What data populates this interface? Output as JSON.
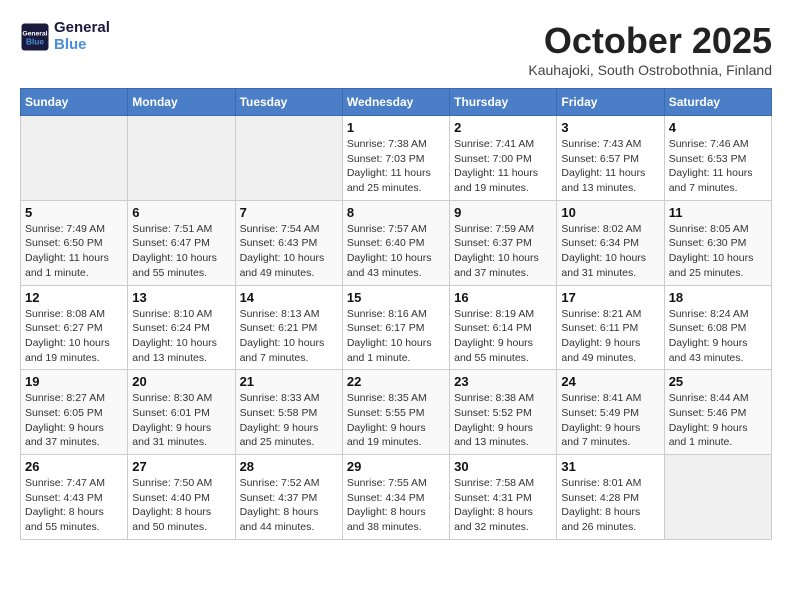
{
  "header": {
    "logo_line1": "General",
    "logo_line2": "Blue",
    "month": "October 2025",
    "location": "Kauhajoki, South Ostrobothnia, Finland"
  },
  "weekdays": [
    "Sunday",
    "Monday",
    "Tuesday",
    "Wednesday",
    "Thursday",
    "Friday",
    "Saturday"
  ],
  "weeks": [
    [
      {
        "day": "",
        "info": ""
      },
      {
        "day": "",
        "info": ""
      },
      {
        "day": "",
        "info": ""
      },
      {
        "day": "1",
        "info": "Sunrise: 7:38 AM\nSunset: 7:03 PM\nDaylight: 11 hours\nand 25 minutes."
      },
      {
        "day": "2",
        "info": "Sunrise: 7:41 AM\nSunset: 7:00 PM\nDaylight: 11 hours\nand 19 minutes."
      },
      {
        "day": "3",
        "info": "Sunrise: 7:43 AM\nSunset: 6:57 PM\nDaylight: 11 hours\nand 13 minutes."
      },
      {
        "day": "4",
        "info": "Sunrise: 7:46 AM\nSunset: 6:53 PM\nDaylight: 11 hours\nand 7 minutes."
      }
    ],
    [
      {
        "day": "5",
        "info": "Sunrise: 7:49 AM\nSunset: 6:50 PM\nDaylight: 11 hours\nand 1 minute."
      },
      {
        "day": "6",
        "info": "Sunrise: 7:51 AM\nSunset: 6:47 PM\nDaylight: 10 hours\nand 55 minutes."
      },
      {
        "day": "7",
        "info": "Sunrise: 7:54 AM\nSunset: 6:43 PM\nDaylight: 10 hours\nand 49 minutes."
      },
      {
        "day": "8",
        "info": "Sunrise: 7:57 AM\nSunset: 6:40 PM\nDaylight: 10 hours\nand 43 minutes."
      },
      {
        "day": "9",
        "info": "Sunrise: 7:59 AM\nSunset: 6:37 PM\nDaylight: 10 hours\nand 37 minutes."
      },
      {
        "day": "10",
        "info": "Sunrise: 8:02 AM\nSunset: 6:34 PM\nDaylight: 10 hours\nand 31 minutes."
      },
      {
        "day": "11",
        "info": "Sunrise: 8:05 AM\nSunset: 6:30 PM\nDaylight: 10 hours\nand 25 minutes."
      }
    ],
    [
      {
        "day": "12",
        "info": "Sunrise: 8:08 AM\nSunset: 6:27 PM\nDaylight: 10 hours\nand 19 minutes."
      },
      {
        "day": "13",
        "info": "Sunrise: 8:10 AM\nSunset: 6:24 PM\nDaylight: 10 hours\nand 13 minutes."
      },
      {
        "day": "14",
        "info": "Sunrise: 8:13 AM\nSunset: 6:21 PM\nDaylight: 10 hours\nand 7 minutes."
      },
      {
        "day": "15",
        "info": "Sunrise: 8:16 AM\nSunset: 6:17 PM\nDaylight: 10 hours\nand 1 minute."
      },
      {
        "day": "16",
        "info": "Sunrise: 8:19 AM\nSunset: 6:14 PM\nDaylight: 9 hours\nand 55 minutes."
      },
      {
        "day": "17",
        "info": "Sunrise: 8:21 AM\nSunset: 6:11 PM\nDaylight: 9 hours\nand 49 minutes."
      },
      {
        "day": "18",
        "info": "Sunrise: 8:24 AM\nSunset: 6:08 PM\nDaylight: 9 hours\nand 43 minutes."
      }
    ],
    [
      {
        "day": "19",
        "info": "Sunrise: 8:27 AM\nSunset: 6:05 PM\nDaylight: 9 hours\nand 37 minutes."
      },
      {
        "day": "20",
        "info": "Sunrise: 8:30 AM\nSunset: 6:01 PM\nDaylight: 9 hours\nand 31 minutes."
      },
      {
        "day": "21",
        "info": "Sunrise: 8:33 AM\nSunset: 5:58 PM\nDaylight: 9 hours\nand 25 minutes."
      },
      {
        "day": "22",
        "info": "Sunrise: 8:35 AM\nSunset: 5:55 PM\nDaylight: 9 hours\nand 19 minutes."
      },
      {
        "day": "23",
        "info": "Sunrise: 8:38 AM\nSunset: 5:52 PM\nDaylight: 9 hours\nand 13 minutes."
      },
      {
        "day": "24",
        "info": "Sunrise: 8:41 AM\nSunset: 5:49 PM\nDaylight: 9 hours\nand 7 minutes."
      },
      {
        "day": "25",
        "info": "Sunrise: 8:44 AM\nSunset: 5:46 PM\nDaylight: 9 hours\nand 1 minute."
      }
    ],
    [
      {
        "day": "26",
        "info": "Sunrise: 7:47 AM\nSunset: 4:43 PM\nDaylight: 8 hours\nand 55 minutes."
      },
      {
        "day": "27",
        "info": "Sunrise: 7:50 AM\nSunset: 4:40 PM\nDaylight: 8 hours\nand 50 minutes."
      },
      {
        "day": "28",
        "info": "Sunrise: 7:52 AM\nSunset: 4:37 PM\nDaylight: 8 hours\nand 44 minutes."
      },
      {
        "day": "29",
        "info": "Sunrise: 7:55 AM\nSunset: 4:34 PM\nDaylight: 8 hours\nand 38 minutes."
      },
      {
        "day": "30",
        "info": "Sunrise: 7:58 AM\nSunset: 4:31 PM\nDaylight: 8 hours\nand 32 minutes."
      },
      {
        "day": "31",
        "info": "Sunrise: 8:01 AM\nSunset: 4:28 PM\nDaylight: 8 hours\nand 26 minutes."
      },
      {
        "day": "",
        "info": ""
      }
    ]
  ]
}
